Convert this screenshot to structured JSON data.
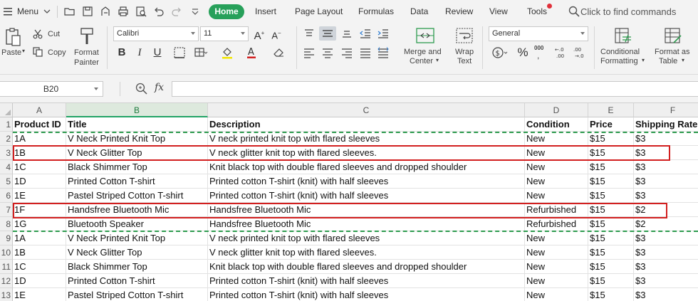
{
  "menubar": {
    "menu_label": "Menu",
    "tabs": [
      "Home",
      "Insert",
      "Page Layout",
      "Formulas",
      "Data",
      "Review",
      "View",
      "Tools"
    ],
    "search_placeholder": "Click to find commands"
  },
  "ribbon": {
    "paste_label": "Paste",
    "cut_label": "Cut",
    "copy_label": "Copy",
    "format_painter_label_1": "Format",
    "format_painter_label_2": "Painter",
    "font_name": "Calibri",
    "font_size": "11",
    "merge_label_1": "Merge and",
    "merge_label_2": "Center",
    "wrap_label_1": "Wrap",
    "wrap_label_2": "Text",
    "number_format": "General",
    "cond_label_1": "Conditional",
    "cond_label_2": "Formatting",
    "fmt_table_label_1": "Format as",
    "fmt_table_label_2": "Table",
    "font_buttons": [
      "B",
      "I",
      "U"
    ],
    "decimal_increase": "←.0\n.00",
    "percent": "%",
    "thousands": "000"
  },
  "formula_bar": {
    "cell_ref": "B20",
    "fx": "fx",
    "value": ""
  },
  "grid": {
    "columns": [
      "A",
      "B",
      "C",
      "D",
      "E",
      "F"
    ],
    "active_column": "B",
    "header_row": [
      "Product ID",
      "Title",
      "Description",
      "Condition",
      "Price",
      "Shipping Rate"
    ],
    "row_numbers": [
      "1",
      "2",
      "3",
      "4",
      "5",
      "6",
      "7",
      "8",
      "9",
      "10",
      "11",
      "12",
      "13"
    ],
    "rows": [
      [
        "1A",
        "V Neck Printed Knit Top",
        "V neck printed knit top with flared sleeves",
        "New",
        "$15",
        "$3"
      ],
      [
        "1B",
        "V Neck Glitter Top",
        "V neck glitter knit top with flared sleeves.",
        "New",
        "$15",
        "$3"
      ],
      [
        "1C",
        "Black Shimmer Top",
        "Knit black top with double flared sleeves and dropped shoulder",
        "New",
        "$15",
        "$3"
      ],
      [
        "1D",
        "Printed Cotton T-shirt",
        "Printed cotton T-shirt (knit) with half sleeves",
        "New",
        "$15",
        "$3"
      ],
      [
        "1E",
        "Pastel Striped Cotton T-shirt",
        "Printed cotton T-shirt (knit) with half sleeves",
        "New",
        "$15",
        "$3"
      ],
      [
        "1F",
        "Handsfree Bluetooth Mic",
        "Handsfree Bluetooth Mic",
        "Refurbished",
        "$15",
        "$2"
      ],
      [
        "1G",
        "Bluetooth Speaker",
        "Handsfree Bluetooth Mic",
        "Refurbished",
        "$15",
        "$2"
      ],
      [
        "1A",
        "V Neck Printed Knit Top",
        "V neck printed knit top with flared sleeves",
        "New",
        "$15",
        "$3"
      ],
      [
        "1B",
        "V Neck Glitter Top",
        "V neck glitter knit top with flared sleeves.",
        "New",
        "$15",
        "$3"
      ],
      [
        "1C",
        "Black Shimmer Top",
        "Knit black top with double flared sleeves and dropped shoulder",
        "New",
        "$15",
        "$3"
      ],
      [
        "1D",
        "Printed Cotton T-shirt",
        "Printed cotton T-shirt (knit) with half sleeves",
        "New",
        "$15",
        "$3"
      ],
      [
        "1E",
        "Pastel Striped Cotton T-shirt",
        "Printed cotton T-shirt (knit) with half sleeves",
        "New",
        "$15",
        "$3"
      ]
    ]
  },
  "colors": {
    "accent": "#27a05a",
    "highlight_box": "#d21f1f",
    "copy_marquee": "#2e9b4f"
  }
}
